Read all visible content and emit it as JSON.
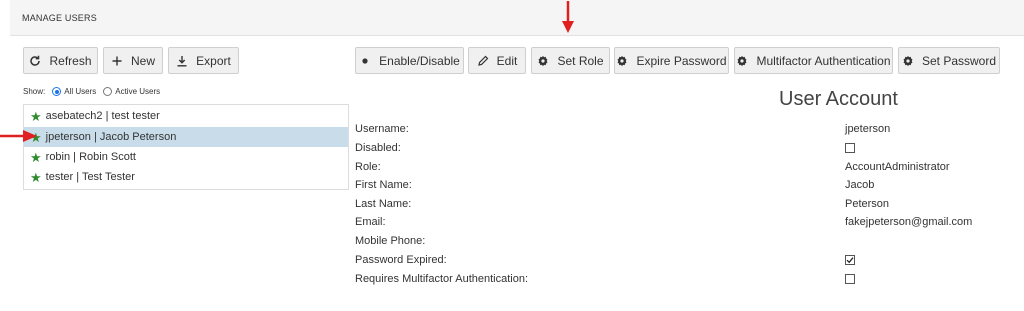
{
  "header": {
    "title": "MANAGE USERS"
  },
  "toolbar_left": {
    "refresh": "Refresh",
    "new": "New",
    "export": "Export"
  },
  "toolbar_right": {
    "enable_disable": "Enable/Disable",
    "edit": "Edit",
    "set_role": "Set Role",
    "expire_password": "Expire Password",
    "multifactor": "Multifactor Authentication",
    "set_password": "Set Password"
  },
  "filter": {
    "show_label": "Show:",
    "all_users": "All Users",
    "active_users": "Active Users",
    "selected": "All Users"
  },
  "users": [
    {
      "label": "asebatech2 | test tester",
      "selected": false
    },
    {
      "label": "jpeterson | Jacob Peterson",
      "selected": true
    },
    {
      "label": "robin | Robin Scott",
      "selected": false
    },
    {
      "label": "tester | Test Tester",
      "selected": false
    }
  ],
  "account": {
    "title": "User Account",
    "labels": {
      "username": "Username:",
      "disabled": "Disabled:",
      "role": "Role:",
      "first_name": "First Name:",
      "last_name": "Last Name:",
      "email": "Email:",
      "mobile_phone": "Mobile Phone:",
      "password_expired": "Password Expired:",
      "requires_mfa": "Requires Multifactor Authentication:"
    },
    "values": {
      "username": "jpeterson",
      "disabled": false,
      "role": "AccountAdministrator",
      "first_name": "Jacob",
      "last_name": "Peterson",
      "email": "fakejpeterson@gmail.com",
      "mobile_phone": "",
      "password_expired": true,
      "requires_mfa": false
    }
  },
  "colors": {
    "selected_row": "#c8dcea",
    "star": "#2e8b2e",
    "annotation_arrow": "#e02020"
  }
}
